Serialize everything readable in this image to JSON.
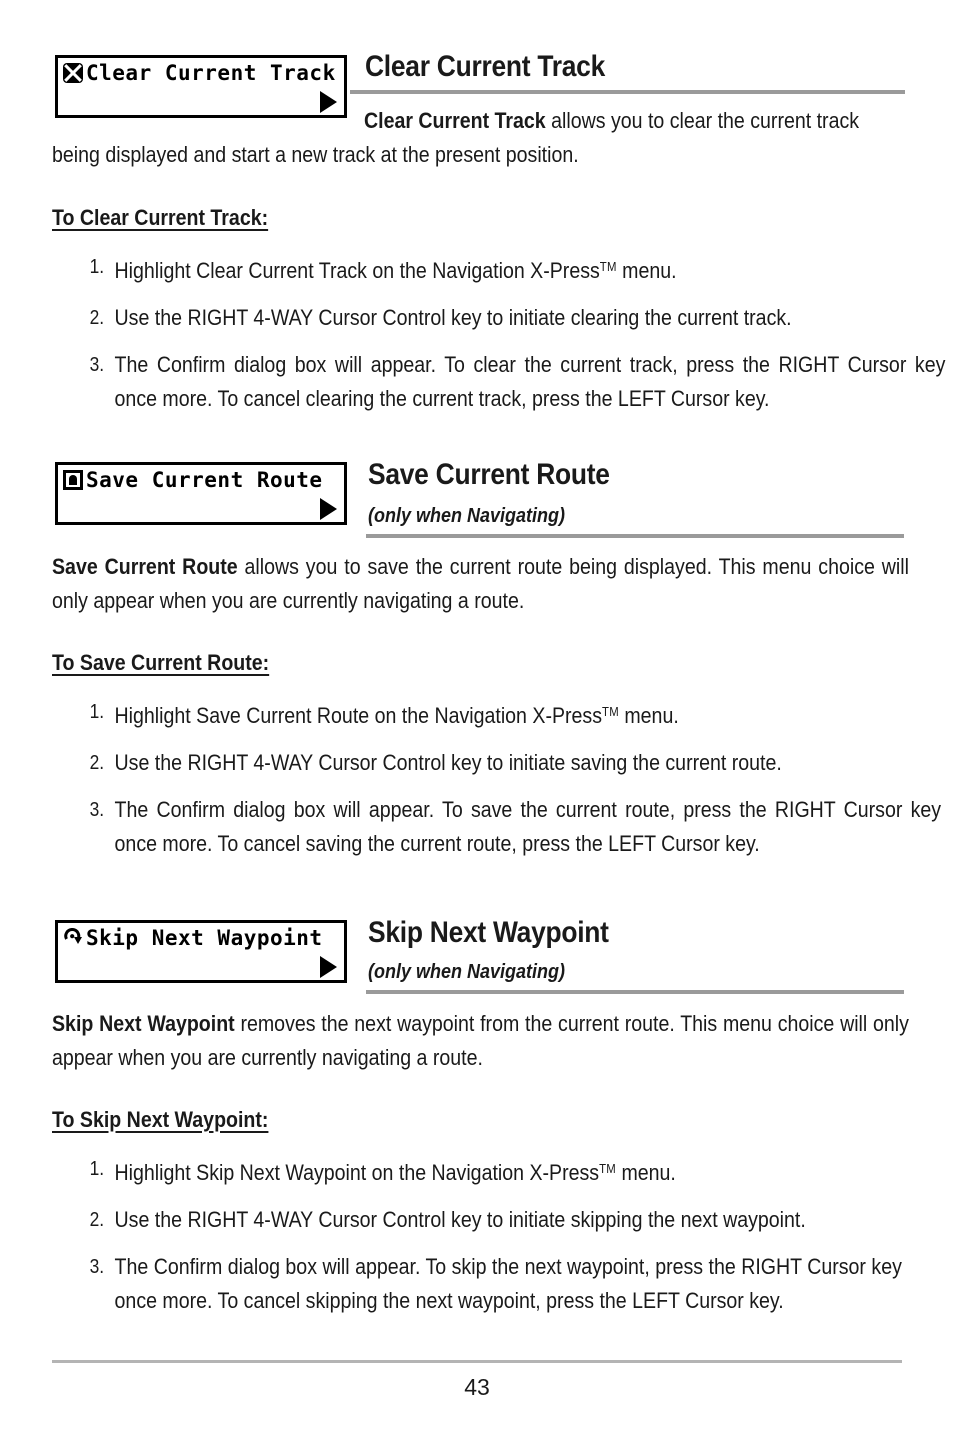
{
  "page": {
    "number": "43"
  },
  "sections": [
    {
      "id": "clear-current-track",
      "lcd": {
        "icon": "x-mark-icon",
        "label": "Clear Current Track",
        "arrow": "right-arrow-icon"
      },
      "heading": "Clear Current Track",
      "subtitle": "",
      "lead_bold": "Clear Current Track",
      "lead_rest": " allows you to clear the current track",
      "lead_line2": "being displayed and start a new track at the present position.",
      "subhead": "To Clear Current Track:",
      "steps": [
        {
          "num": "1.",
          "pre": "Highlight Clear Current Track on the Navigation X-Press",
          "tm": "TM",
          "post": " menu."
        },
        {
          "num": "2.",
          "pre": "Use the RIGHT 4-WAY Cursor Control key to initiate clearing the current track.",
          "tm": "",
          "post": ""
        },
        {
          "num": "3.",
          "pre": "The Confirm dialog box will appear. To clear the current track, press the RIGHT Cursor key once more. To cancel clearing the current track, press the LEFT Cursor key.",
          "tm": "",
          "post": ""
        }
      ]
    },
    {
      "id": "save-current-route",
      "lcd": {
        "icon": "save-disk-icon",
        "label": "Save Current Route",
        "arrow": "right-arrow-icon"
      },
      "heading": "Save Current Route",
      "subtitle": "(only when Navigating)",
      "body_bold": "Save Current Route",
      "body_rest": " allows you to save the current route being displayed. This menu choice will only appear when you are currently navigating a route.",
      "subhead": "To Save Current Route:",
      "steps": [
        {
          "num": "1.",
          "pre": "Highlight Save Current Route on the Navigation X-Press",
          "tm": "TM",
          "post": " menu."
        },
        {
          "num": "2.",
          "pre": "Use the RIGHT 4-WAY Cursor Control key to initiate saving the current route.",
          "tm": "",
          "post": ""
        },
        {
          "num": "3.",
          "pre": "The Confirm dialog box will appear. To save the current route,  press the RIGHT Cursor key once more. To cancel saving the current route, press the LEFT Cursor key.",
          "tm": "",
          "post": ""
        }
      ]
    },
    {
      "id": "skip-next-waypoint",
      "lcd": {
        "icon": "circular-arrow-icon",
        "label": "Skip Next Waypoint",
        "arrow": "right-arrow-icon"
      },
      "heading": "Skip Next Waypoint",
      "subtitle": "(only when Navigating)",
      "body_bold": "Skip Next Waypoint",
      "body_rest": " removes the next waypoint from the current route. This menu choice will only appear when you are currently navigating a route.",
      "subhead": "To Skip Next Waypoint:",
      "steps": [
        {
          "num": "1.",
          "pre": "Highlight Skip Next Waypoint on the Navigation X-Press",
          "tm": "TM",
          "post": " menu."
        },
        {
          "num": "2.",
          "pre": "Use the RIGHT 4-WAY Cursor Control key to initiate skipping the next waypoint.",
          "tm": "",
          "post": ""
        },
        {
          "num": "3.",
          "pre": "The Confirm dialog box will appear. To skip the next waypoint,  press the RIGHT Cursor key once more. To cancel skipping the next waypoint, press the LEFT Cursor key.",
          "tm": "",
          "post": ""
        }
      ]
    }
  ],
  "colors": {
    "rule": "#9a9a9a",
    "footer_rule": "#b4b4b4",
    "text": "#1a1a1a"
  }
}
